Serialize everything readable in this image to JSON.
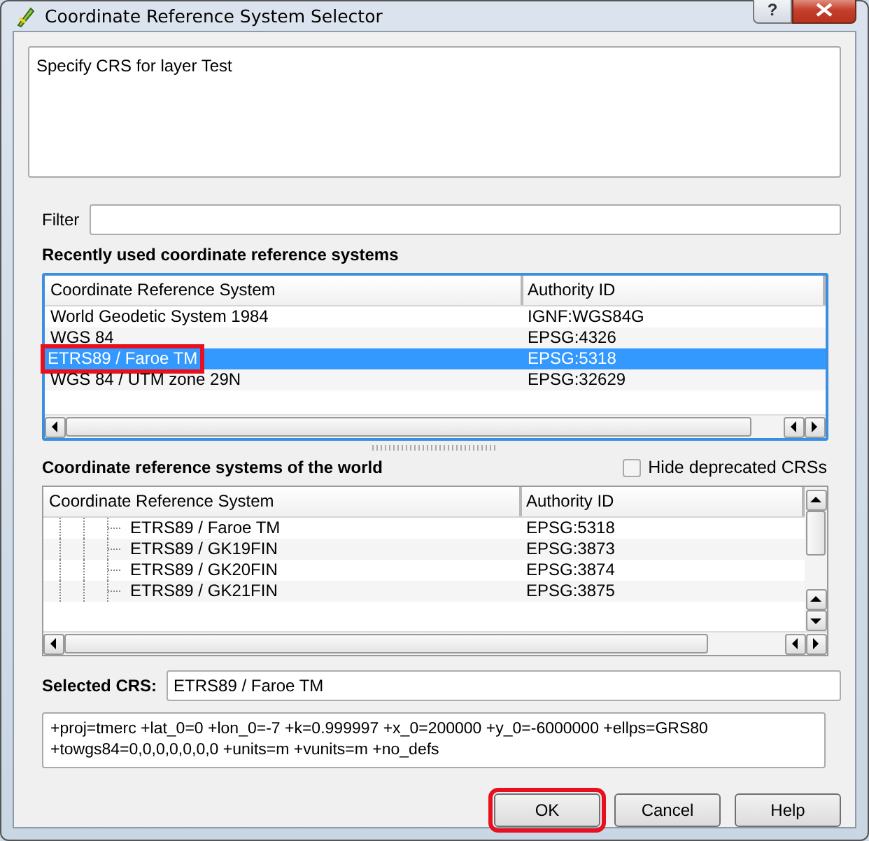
{
  "window": {
    "title": "Coordinate Reference System Selector",
    "help_glyph": "?"
  },
  "message": "Specify CRS for layer Test",
  "filter": {
    "label": "Filter"
  },
  "recent": {
    "heading": "Recently used coordinate reference systems",
    "columns": [
      "Coordinate Reference System",
      "Authority ID"
    ],
    "rows": [
      {
        "crs": "World Geodetic System 1984",
        "authority_id": "IGNF:WGS84G",
        "selected": false,
        "highlighted": false
      },
      {
        "crs": "WGS 84",
        "authority_id": "EPSG:4326",
        "selected": false,
        "highlighted": false
      },
      {
        "crs": "ETRS89 / Faroe TM",
        "authority_id": "EPSG:5318",
        "selected": true,
        "highlighted": true
      },
      {
        "crs": "WGS 84 / UTM zone 29N",
        "authority_id": "EPSG:32629",
        "selected": false,
        "highlighted": false
      }
    ]
  },
  "world": {
    "heading": "Coordinate reference systems of the world",
    "hide_deprecated": {
      "label": "Hide deprecated CRSs",
      "checked": false
    },
    "columns": [
      "Coordinate Reference System",
      "Authority ID"
    ],
    "rows": [
      {
        "crs": "ETRS89 / Faroe TM",
        "authority_id": "EPSG:5318",
        "selected": false
      },
      {
        "crs": "ETRS89 / GK19FIN",
        "authority_id": "EPSG:3873",
        "selected": false
      },
      {
        "crs": "ETRS89 / GK20FIN",
        "authority_id": "EPSG:3874",
        "selected": false
      },
      {
        "crs": "ETRS89 / GK21FIN",
        "authority_id": "EPSG:3875",
        "selected": false
      }
    ]
  },
  "selected_crs": {
    "label": "Selected CRS:",
    "value": "ETRS89 / Faroe TM"
  },
  "proj_definition": "+proj=tmerc +lat_0=0 +lon_0=-7 +k=0.999997 +x_0=200000 +y_0=-6000000 +ellps=GRS80 +towgs84=0,0,0,0,0,0,0 +units=m +vunits=m +no_defs",
  "buttons": [
    {
      "label": "OK",
      "highlighted": true
    },
    {
      "label": "Cancel",
      "highlighted": false
    },
    {
      "label": "Help",
      "highlighted": false
    }
  ]
}
